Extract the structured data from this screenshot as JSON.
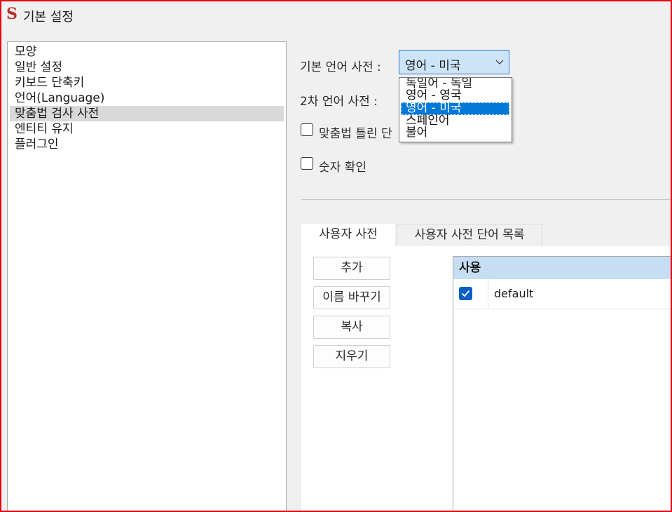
{
  "window": {
    "title": "기본 설정",
    "app_icon_glyph": "S",
    "border_color": "#e8000e"
  },
  "categories": [
    {
      "label": "모양"
    },
    {
      "label": "일반 설정"
    },
    {
      "label": "키보드 단축키"
    },
    {
      "label": "언어(Language)"
    },
    {
      "label": "맞춤법 검사 사전",
      "selected": true
    },
    {
      "label": "엔티티 유지"
    },
    {
      "label": "플러그인"
    }
  ],
  "primary_dictionary": {
    "label": "기본 언어 사전 :",
    "value": "영어 - 미국",
    "options": [
      "독일어 - 독일",
      "영어 - 영국",
      "영어 - 미국",
      "스페인어",
      "불어"
    ],
    "selected_option": "영어 - 미국"
  },
  "secondary_dictionary": {
    "label": "2차 언어 사전 :"
  },
  "checkboxes": {
    "mark_misspelled_label": "맞춤법 틀린 단",
    "check_numbers_label": "숫자 확인"
  },
  "tabs": [
    {
      "label": "사용자 사전",
      "active": true
    },
    {
      "label": "사용자 사전 단어 목록",
      "active": false
    }
  ],
  "buttons": {
    "add": "추가",
    "rename": "이름 바꾸기",
    "copy": "복사",
    "delete": "지우기"
  },
  "dictionary_table": {
    "header": "사용",
    "rows": [
      {
        "enabled": true,
        "name": "default"
      }
    ]
  },
  "colors": {
    "accent": "#0078d7",
    "selection_gray": "#d9d9d9",
    "header_blue": "#c6def3"
  }
}
